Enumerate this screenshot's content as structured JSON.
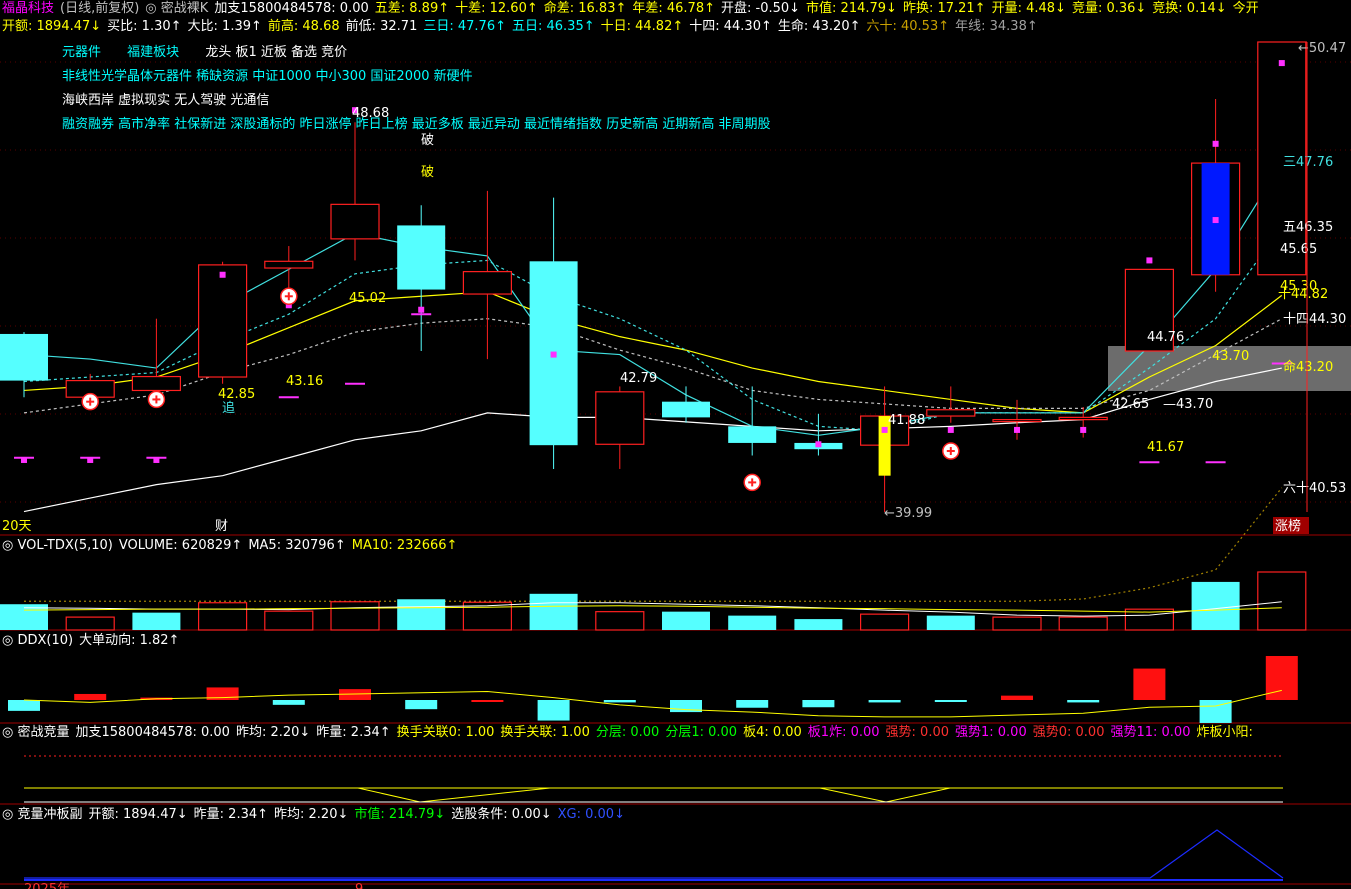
{
  "header_row1": [
    {
      "t": "福晶科技",
      "c": "m"
    },
    {
      "t": "(日线,前复权)",
      "c": "k"
    },
    {
      "t": "◎ 密战裸K",
      "c": "k"
    },
    {
      "t": "加支15800484578: 0.00",
      "c": "w"
    },
    {
      "t": "五差: 8.89↑",
      "c": "y"
    },
    {
      "t": "十差: 12.60↑",
      "c": "y"
    },
    {
      "t": "命差: 16.83↑",
      "c": "y"
    },
    {
      "t": "年差: 46.78↑",
      "c": "y"
    },
    {
      "t": "开盘: -0.50↓",
      "c": "w"
    },
    {
      "t": "市值: 214.79↓",
      "c": "y"
    },
    {
      "t": "昨换: 17.21↑",
      "c": "y"
    },
    {
      "t": "开量: 4.48↓",
      "c": "y"
    },
    {
      "t": "竞量: 0.36↓",
      "c": "y"
    },
    {
      "t": "竞换: 0.14↓",
      "c": "y"
    },
    {
      "t": "今开",
      "c": "y"
    }
  ],
  "header_row2": [
    {
      "t": "开额: 1894.47↓",
      "c": "y"
    },
    {
      "t": "买比: 1.30↑",
      "c": "w"
    },
    {
      "t": "大比: 1.39↑",
      "c": "w"
    },
    {
      "t": "前高: 48.68",
      "c": "y"
    },
    {
      "t": "前低: 32.71",
      "c": "w"
    },
    {
      "t": "三日: 47.76↑",
      "c": "c"
    },
    {
      "t": "五日: 46.35↑",
      "c": "c"
    },
    {
      "t": "十日: 44.82↑",
      "c": "y"
    },
    {
      "t": "十四: 44.30↑",
      "c": "w"
    },
    {
      "t": "生命: 43.20↑",
      "c": "w"
    },
    {
      "t": "六十: 40.53↑",
      "c": "o"
    },
    {
      "t": "年线: 34.38↑",
      "c": "gr"
    }
  ],
  "tags": [
    {
      "t": "元器件     福建板块    龙头 板1 近板 备选 竞价",
      "c": "mixed"
    },
    {
      "t": "非线性光学晶体元器件 稀缺资源 中证1000 中小300 国证2000 新硬件",
      "c": "c"
    },
    {
      "t": "海峡西岸 虚拟现实 无人驾驶 光通信",
      "c": "w"
    },
    {
      "t": "融资融券 高市净率 社保新进 深股通标的 昨日涨停 昨日上榜 最近多板 最近异动 最近情绪指数 历史新高 近期新高 非周期股",
      "c": "c"
    }
  ],
  "tag_row1": {
    "a": "元器件",
    "b": "福建板块",
    "c": "龙头 板1 近板 备选 竞价"
  },
  "price_labels": {
    "high_top": "50.47",
    "ma3": "三47.76",
    "ma5": "五46.35",
    "ma5b": "45.65",
    "ma10": "45.30",
    "ma10b": "十44.82",
    "ma14": "十四44.30",
    "life": "命43.20",
    "sixty": "六十40.53",
    "p4868": "48.68",
    "p4502": "45.02",
    "p4285": "42.85",
    "p4316": "43.16",
    "p4279": "42.79",
    "p4188": "41.88",
    "p3999": "39.99",
    "p4476": "44.76",
    "p4370": "43.70",
    "p4265": "42.65",
    "p4370b": "43.70",
    "p4167": "41.67",
    "po": "破",
    "zhui": "追",
    "days": "20天",
    "cai": "财",
    "zhangbang": "涨榜"
  },
  "vol_panel": [
    {
      "t": "◎ VOL-TDX(5,10)",
      "c": "w"
    },
    {
      "t": "VOLUME: 620829↑",
      "c": "w"
    },
    {
      "t": "MA5: 320796↑",
      "c": "w"
    },
    {
      "t": "MA10: 232666↑",
      "c": "y"
    }
  ],
  "ddx_panel": [
    {
      "t": "◎ DDX(10)",
      "c": "w"
    },
    {
      "t": "大单动向: 1.82↑",
      "c": "w"
    }
  ],
  "mz_panel": [
    {
      "t": "◎ 密战竞量",
      "c": "w"
    },
    {
      "t": "加支15800484578: 0.00",
      "c": "w"
    },
    {
      "t": "昨均: 2.20↓",
      "c": "w"
    },
    {
      "t": "昨量: 2.34↑",
      "c": "w"
    },
    {
      "t": "换手关联0: 1.00",
      "c": "y"
    },
    {
      "t": "换手关联: 1.00",
      "c": "y"
    },
    {
      "t": "分层: 0.00",
      "c": "g"
    },
    {
      "t": "分层1: 0.00",
      "c": "g"
    },
    {
      "t": "板4: 0.00",
      "c": "y"
    },
    {
      "t": "板1炸: 0.00",
      "c": "m"
    },
    {
      "t": "强势: 0.00",
      "c": "r"
    },
    {
      "t": "强势1: 0.00",
      "c": "m"
    },
    {
      "t": "强势0: 0.00",
      "c": "r"
    },
    {
      "t": "强势11: 0.00",
      "c": "m"
    },
    {
      "t": "炸板小阳:",
      "c": "y"
    }
  ],
  "jl_panel": [
    {
      "t": "◎ 竞量冲板副",
      "c": "w"
    },
    {
      "t": "开额: 1894.47↓",
      "c": "w"
    },
    {
      "t": "昨量: 2.34↑",
      "c": "w"
    },
    {
      "t": "昨均: 2.20↓",
      "c": "w"
    },
    {
      "t": "市值: 214.79↓",
      "c": "g"
    },
    {
      "t": "选股条件: 0.00↓",
      "c": "w"
    },
    {
      "t": "XG: 0.00↓",
      "c": "b"
    }
  ],
  "bottom_text": {
    "year": "2025年",
    "mark": "9"
  },
  "colors": {
    "up": "#ff2020",
    "down": "#55ffff",
    "ma3": "#40e0e0",
    "ma10": "#ffff00",
    "life": "#ffffff",
    "ma5dash": "#40e0e0",
    "ma14dash": "#c0c0c0",
    "sixty": "#a08000"
  },
  "candles": [
    {
      "o": 43.96,
      "h": 44.0,
      "l": 42.55,
      "c": 42.92
    },
    {
      "o": 42.55,
      "h": 43.07,
      "l": 42.32,
      "c": 42.92
    },
    {
      "o": 42.7,
      "h": 44.3,
      "l": 42.55,
      "c": 43.01
    },
    {
      "o": 43.0,
      "h": 45.57,
      "l": 42.85,
      "c": 45.5
    },
    {
      "o": 45.43,
      "h": 45.92,
      "l": 44.93,
      "c": 45.58
    },
    {
      "o": 46.08,
      "h": 48.68,
      "l": 45.6,
      "c": 46.85
    },
    {
      "o": 46.38,
      "h": 46.83,
      "l": 43.58,
      "c": 44.95
    },
    {
      "o": 44.85,
      "h": 47.15,
      "l": 43.4,
      "c": 45.35
    },
    {
      "o": 45.58,
      "h": 47.0,
      "l": 40.95,
      "c": 41.48
    },
    {
      "o": 41.5,
      "h": 42.79,
      "l": 40.95,
      "c": 42.67
    },
    {
      "o": 42.45,
      "h": 42.79,
      "l": 41.98,
      "c": 42.1
    },
    {
      "o": 41.9,
      "h": 42.79,
      "l": 41.25,
      "c": 41.53
    },
    {
      "o": 41.53,
      "h": 42.18,
      "l": 41.25,
      "c": 41.39
    },
    {
      "o": 41.48,
      "h": 42.79,
      "l": 39.99,
      "c": 42.13
    },
    {
      "o": 42.13,
      "h": 42.79,
      "l": 41.98,
      "c": 42.27
    },
    {
      "o": 42.05,
      "h": 42.49,
      "l": 41.6,
      "c": 42.05
    },
    {
      "o": 42.05,
      "h": 42.33,
      "l": 41.65,
      "c": 42.1
    },
    {
      "o": 43.58,
      "h": 44.9,
      "l": 43.58,
      "c": 45.4
    },
    {
      "o": 45.28,
      "h": 49.2,
      "l": 44.9,
      "c": 47.77
    },
    {
      "o": 45.28,
      "h": 50.47,
      "l": 45.28,
      "c": 50.47
    }
  ],
  "ma3": [
    43.5,
    43.4,
    43.2,
    44.6,
    45.4,
    46.2,
    45.9,
    45.7,
    43.6,
    43.5,
    42.6,
    41.9,
    41.7,
    41.9,
    42.2,
    42.2,
    42.2,
    43.7,
    45.4,
    47.76
  ],
  "ma5": [
    42.9,
    43.0,
    43.1,
    43.8,
    44.4,
    45.3,
    45.5,
    45.6,
    44.8,
    44.3,
    43.6,
    42.5,
    41.9,
    41.8,
    42.2,
    42.2,
    42.2,
    43.2,
    44.3,
    46.35
  ],
  "ma10": [
    42.7,
    42.8,
    43.0,
    43.5,
    44.1,
    44.7,
    44.8,
    44.9,
    44.3,
    43.9,
    43.6,
    43.2,
    42.9,
    42.7,
    42.5,
    42.3,
    42.2,
    43.0,
    43.7,
    44.82
  ],
  "ma14": [
    42.2,
    42.4,
    42.6,
    43.1,
    43.5,
    44.0,
    44.2,
    44.3,
    44.1,
    43.6,
    43.2,
    42.7,
    42.5,
    42.4,
    42.3,
    42.3,
    42.3,
    42.7,
    43.5,
    44.3
  ],
  "life": [
    40.0,
    40.3,
    40.6,
    40.8,
    41.2,
    41.6,
    41.8,
    42.2,
    42.1,
    42.1,
    42.0,
    41.9,
    41.8,
    41.85,
    41.9,
    41.98,
    42.05,
    42.5,
    42.9,
    43.2
  ],
  "sixty": [
    38.0,
    38.0,
    38.0,
    38.0,
    38.0,
    38.0,
    38.0,
    38.0,
    38.0,
    38.0,
    38.0,
    38.0,
    38.0,
    38.0,
    38.0,
    38.0,
    38.05,
    38.3,
    38.7,
    40.53
  ],
  "vol": [
    0.52,
    0.26,
    0.35,
    0.55,
    0.38,
    0.57,
    0.62,
    0.56,
    0.73,
    0.37,
    0.37,
    0.29,
    0.22,
    0.32,
    0.29,
    0.26,
    0.26,
    0.42,
    0.97,
    1.17
  ],
  "vol_up": [
    false,
    true,
    false,
    true,
    true,
    true,
    false,
    true,
    false,
    true,
    false,
    false,
    false,
    true,
    false,
    true,
    true,
    true,
    false,
    true
  ],
  "ddx": [
    -0.45,
    0.25,
    0.1,
    0.52,
    -0.2,
    0.45,
    -0.38,
    0.0,
    -0.85,
    -0.1,
    -0.5,
    -0.32,
    -0.3,
    -0.1,
    -0.05,
    0.18,
    -0.1,
    1.3,
    -0.95,
    1.82
  ]
}
